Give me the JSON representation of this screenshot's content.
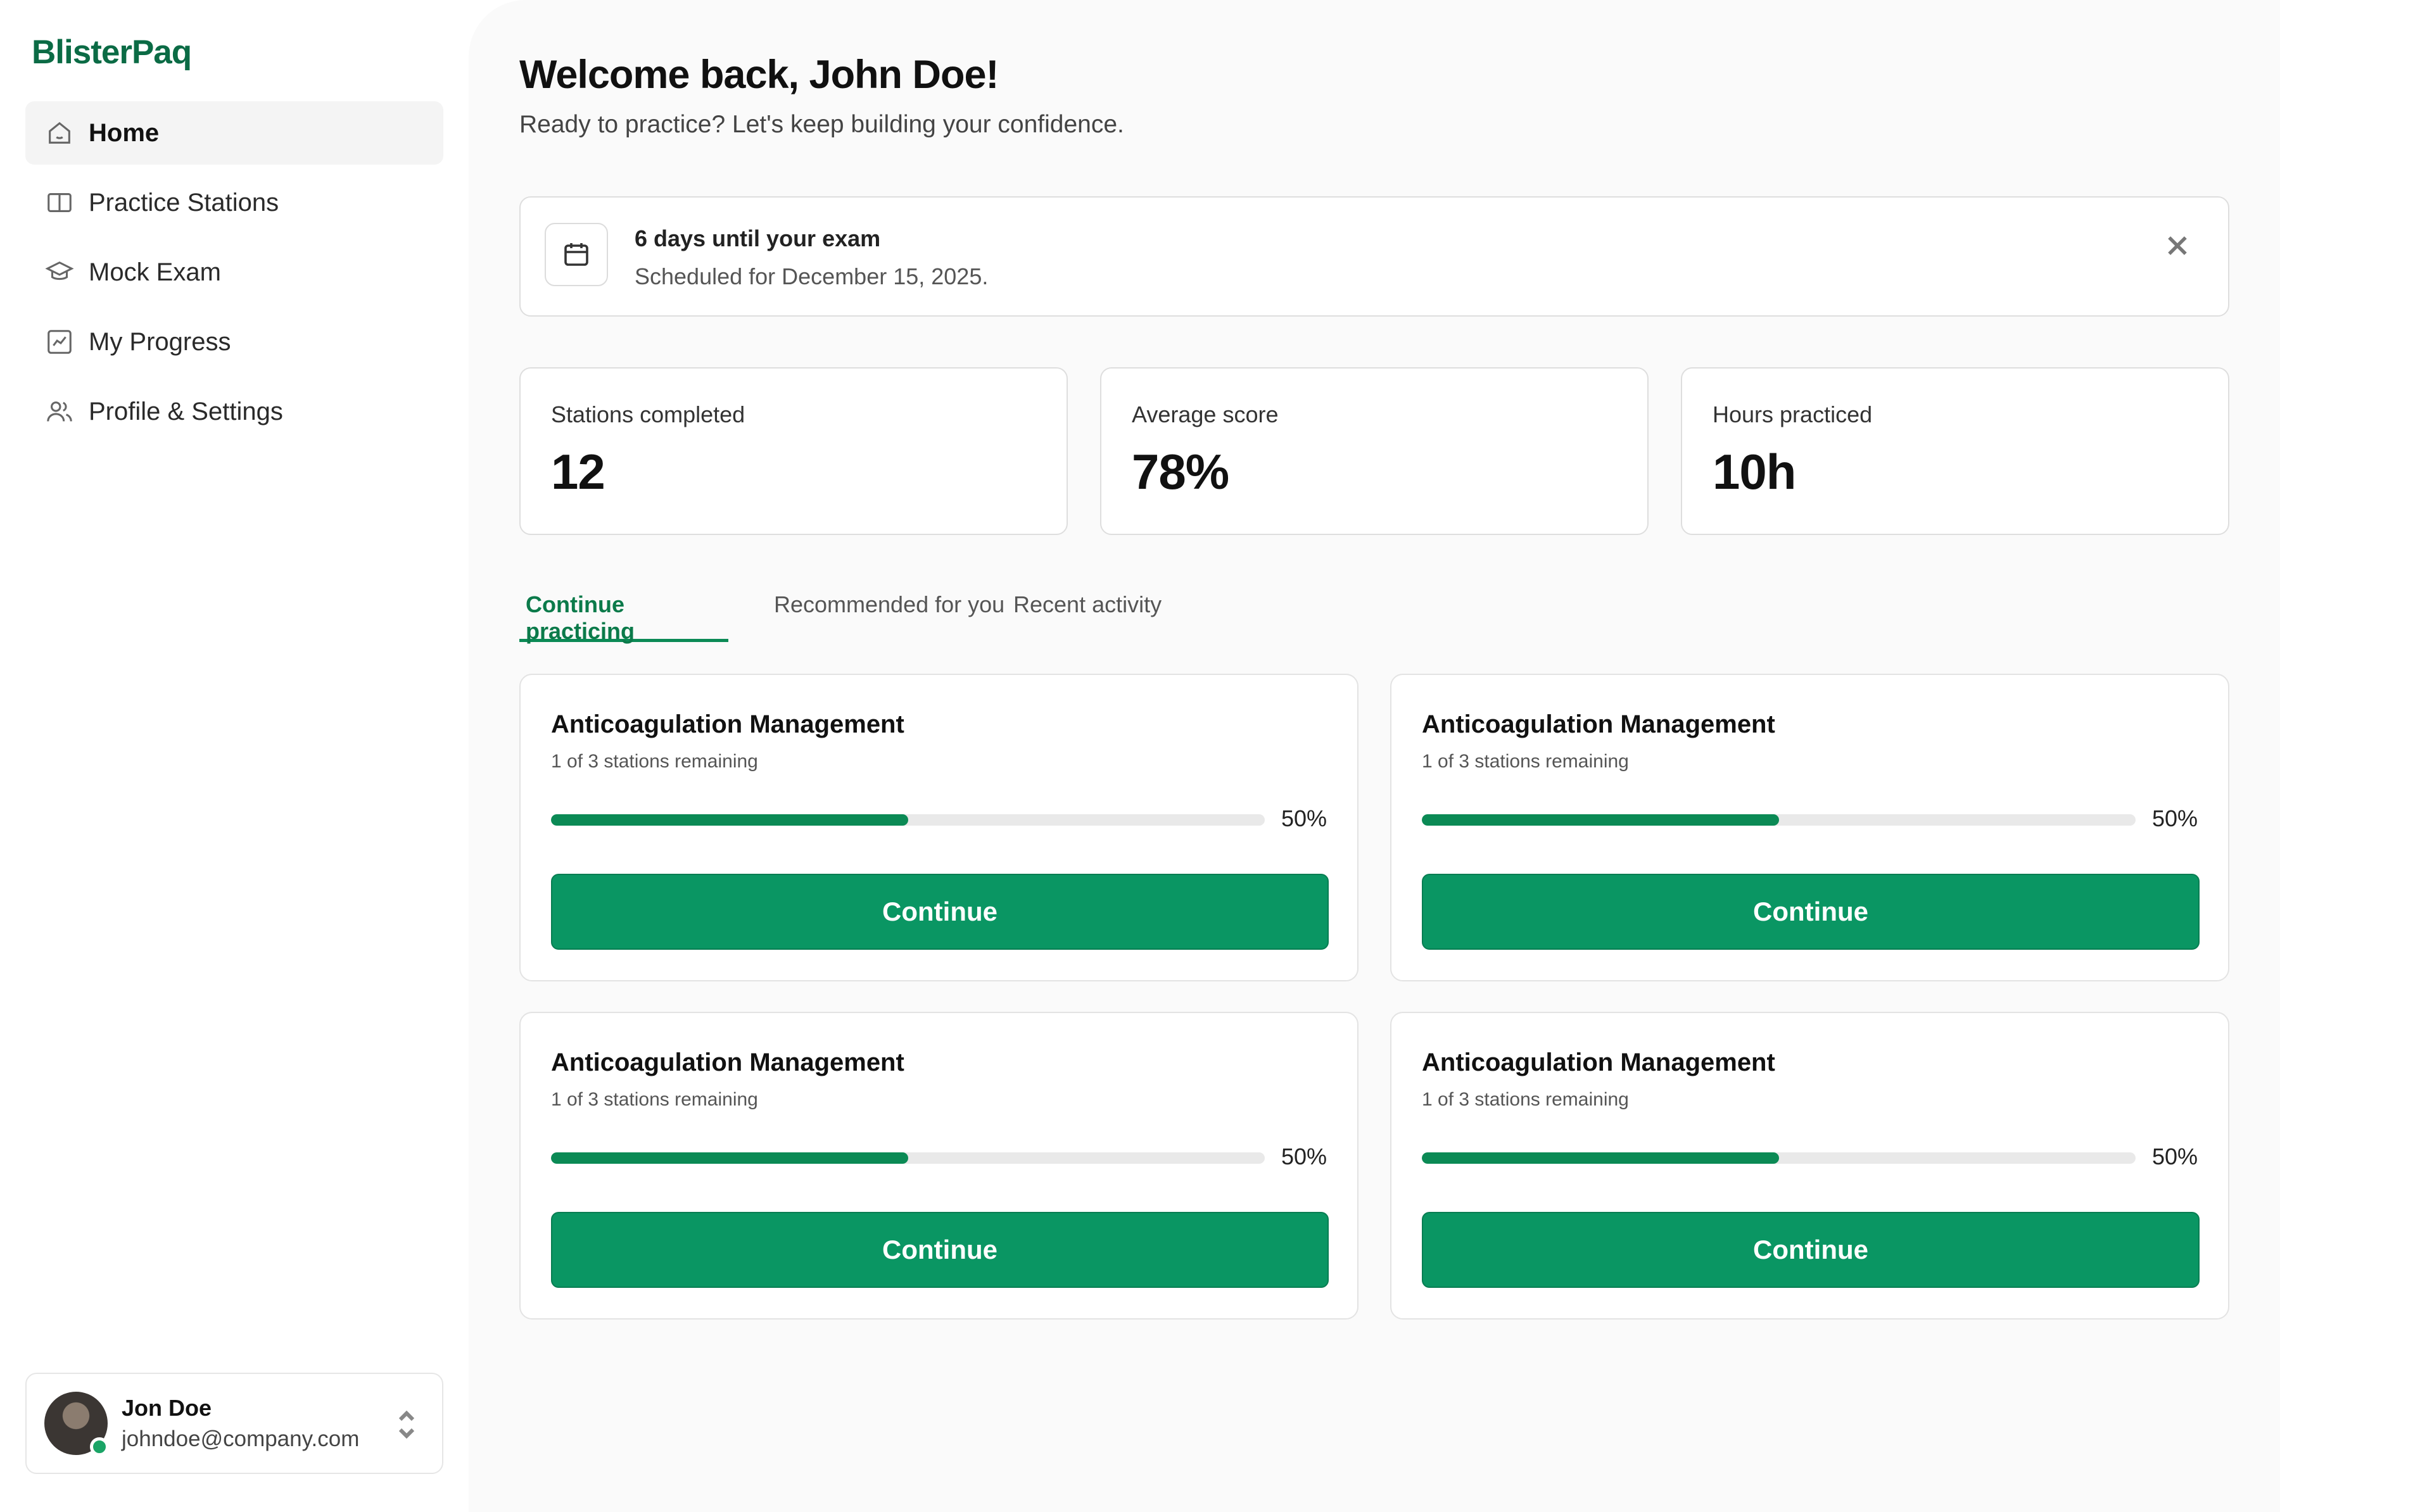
{
  "brand": {
    "name": "BlisterPaq",
    "color": "#0b6b45"
  },
  "sidebar": {
    "items": [
      {
        "label": "Home",
        "icon": "home-icon",
        "active": true
      },
      {
        "label": "Practice Stations",
        "icon": "book-open-icon",
        "active": false
      },
      {
        "label": "Mock Exam",
        "icon": "graduation-cap-icon",
        "active": false
      },
      {
        "label": "My Progress",
        "icon": "chart-icon",
        "active": false
      },
      {
        "label": "Profile & Settings",
        "icon": "users-icon",
        "active": false
      }
    ],
    "user": {
      "name": "Jon Doe",
      "email": "johndoe@company.com",
      "status": "online"
    }
  },
  "main": {
    "welcome": "Welcome back, John Doe!",
    "subtitle": "Ready to practice? Let's keep building your confidence.",
    "exam_banner": {
      "title": "6 days until your exam",
      "subtitle": "Scheduled for December 15, 2025.",
      "icon": "calendar-icon"
    },
    "stats": [
      {
        "label": "Stations completed",
        "value": "12"
      },
      {
        "label": "Average score",
        "value": "78%"
      },
      {
        "label": "Hours practiced",
        "value": "10h"
      }
    ],
    "tabs": [
      {
        "label": "Continue practicing",
        "active": true
      },
      {
        "label": "Recommended for you",
        "active": false
      },
      {
        "label": "Recent activity",
        "active": false
      }
    ],
    "cards": [
      {
        "title": "Anticoagulation Management",
        "subtitle": "1 of 3 stations remaining",
        "progress": 0.5,
        "progress_label": "50%",
        "button": "Continue"
      },
      {
        "title": "Anticoagulation Management",
        "subtitle": "1 of 3 stations remaining",
        "progress": 0.5,
        "progress_label": "50%",
        "button": "Continue"
      },
      {
        "title": "Anticoagulation Management",
        "subtitle": "1 of 3 stations remaining",
        "progress": 0.5,
        "progress_label": "50%",
        "button": "Continue"
      },
      {
        "title": "Anticoagulation Management",
        "subtitle": "1 of 3 stations remaining",
        "progress": 0.5,
        "progress_label": "50%",
        "button": "Continue"
      }
    ]
  },
  "colors": {
    "accent": "#0a9663",
    "accent_dark": "#0b7a4a",
    "online": "#1aa466"
  }
}
